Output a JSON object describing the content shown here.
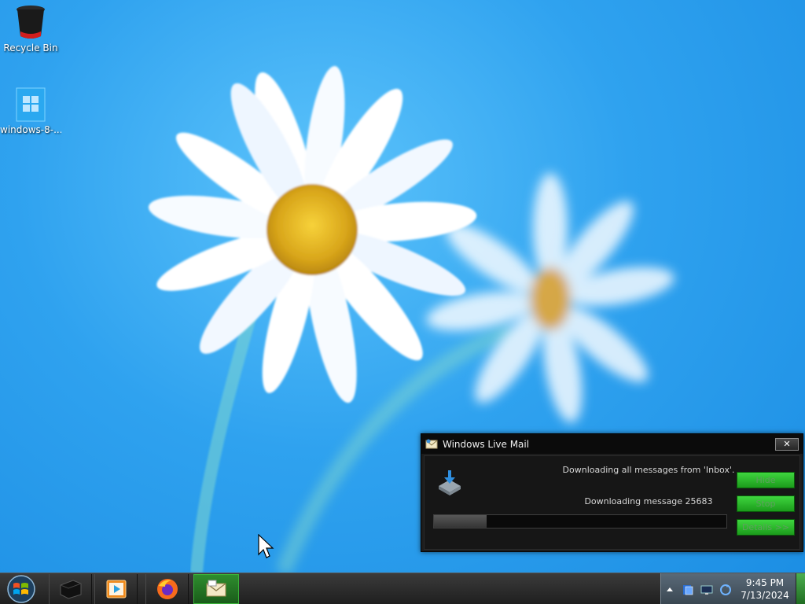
{
  "desktop": {
    "icons": [
      {
        "label": "Recycle Bin",
        "icon": "recycle-bin-icon"
      },
      {
        "label": "windows-8-...",
        " icon": "windows-logo-icon"
      }
    ]
  },
  "dialog": {
    "title": "Windows Live Mail",
    "close_label": "✕",
    "status": "Downloading all messages from 'Inbox'.",
    "count": "Downloading message 25683",
    "progress": 0.18,
    "buttons": {
      "hide": "Hide",
      "stop": "Stop",
      "details": "Details >>"
    }
  },
  "taskbar": {
    "items": [
      {
        "icon": "start-orb-icon"
      },
      {
        "icon": "black-app-icon"
      },
      {
        "icon": "media-player-icon"
      },
      {
        "icon": "firefox-icon"
      },
      {
        "icon": "windows-live-mail-icon"
      }
    ]
  },
  "tray": {
    "time": "9:45 PM",
    "date": "7/13/2024"
  },
  "colors": {
    "accent_green": "#2fbf2f",
    "dialog_bg": "#1c1c1c",
    "sky_blue": "#2fa2ef"
  }
}
